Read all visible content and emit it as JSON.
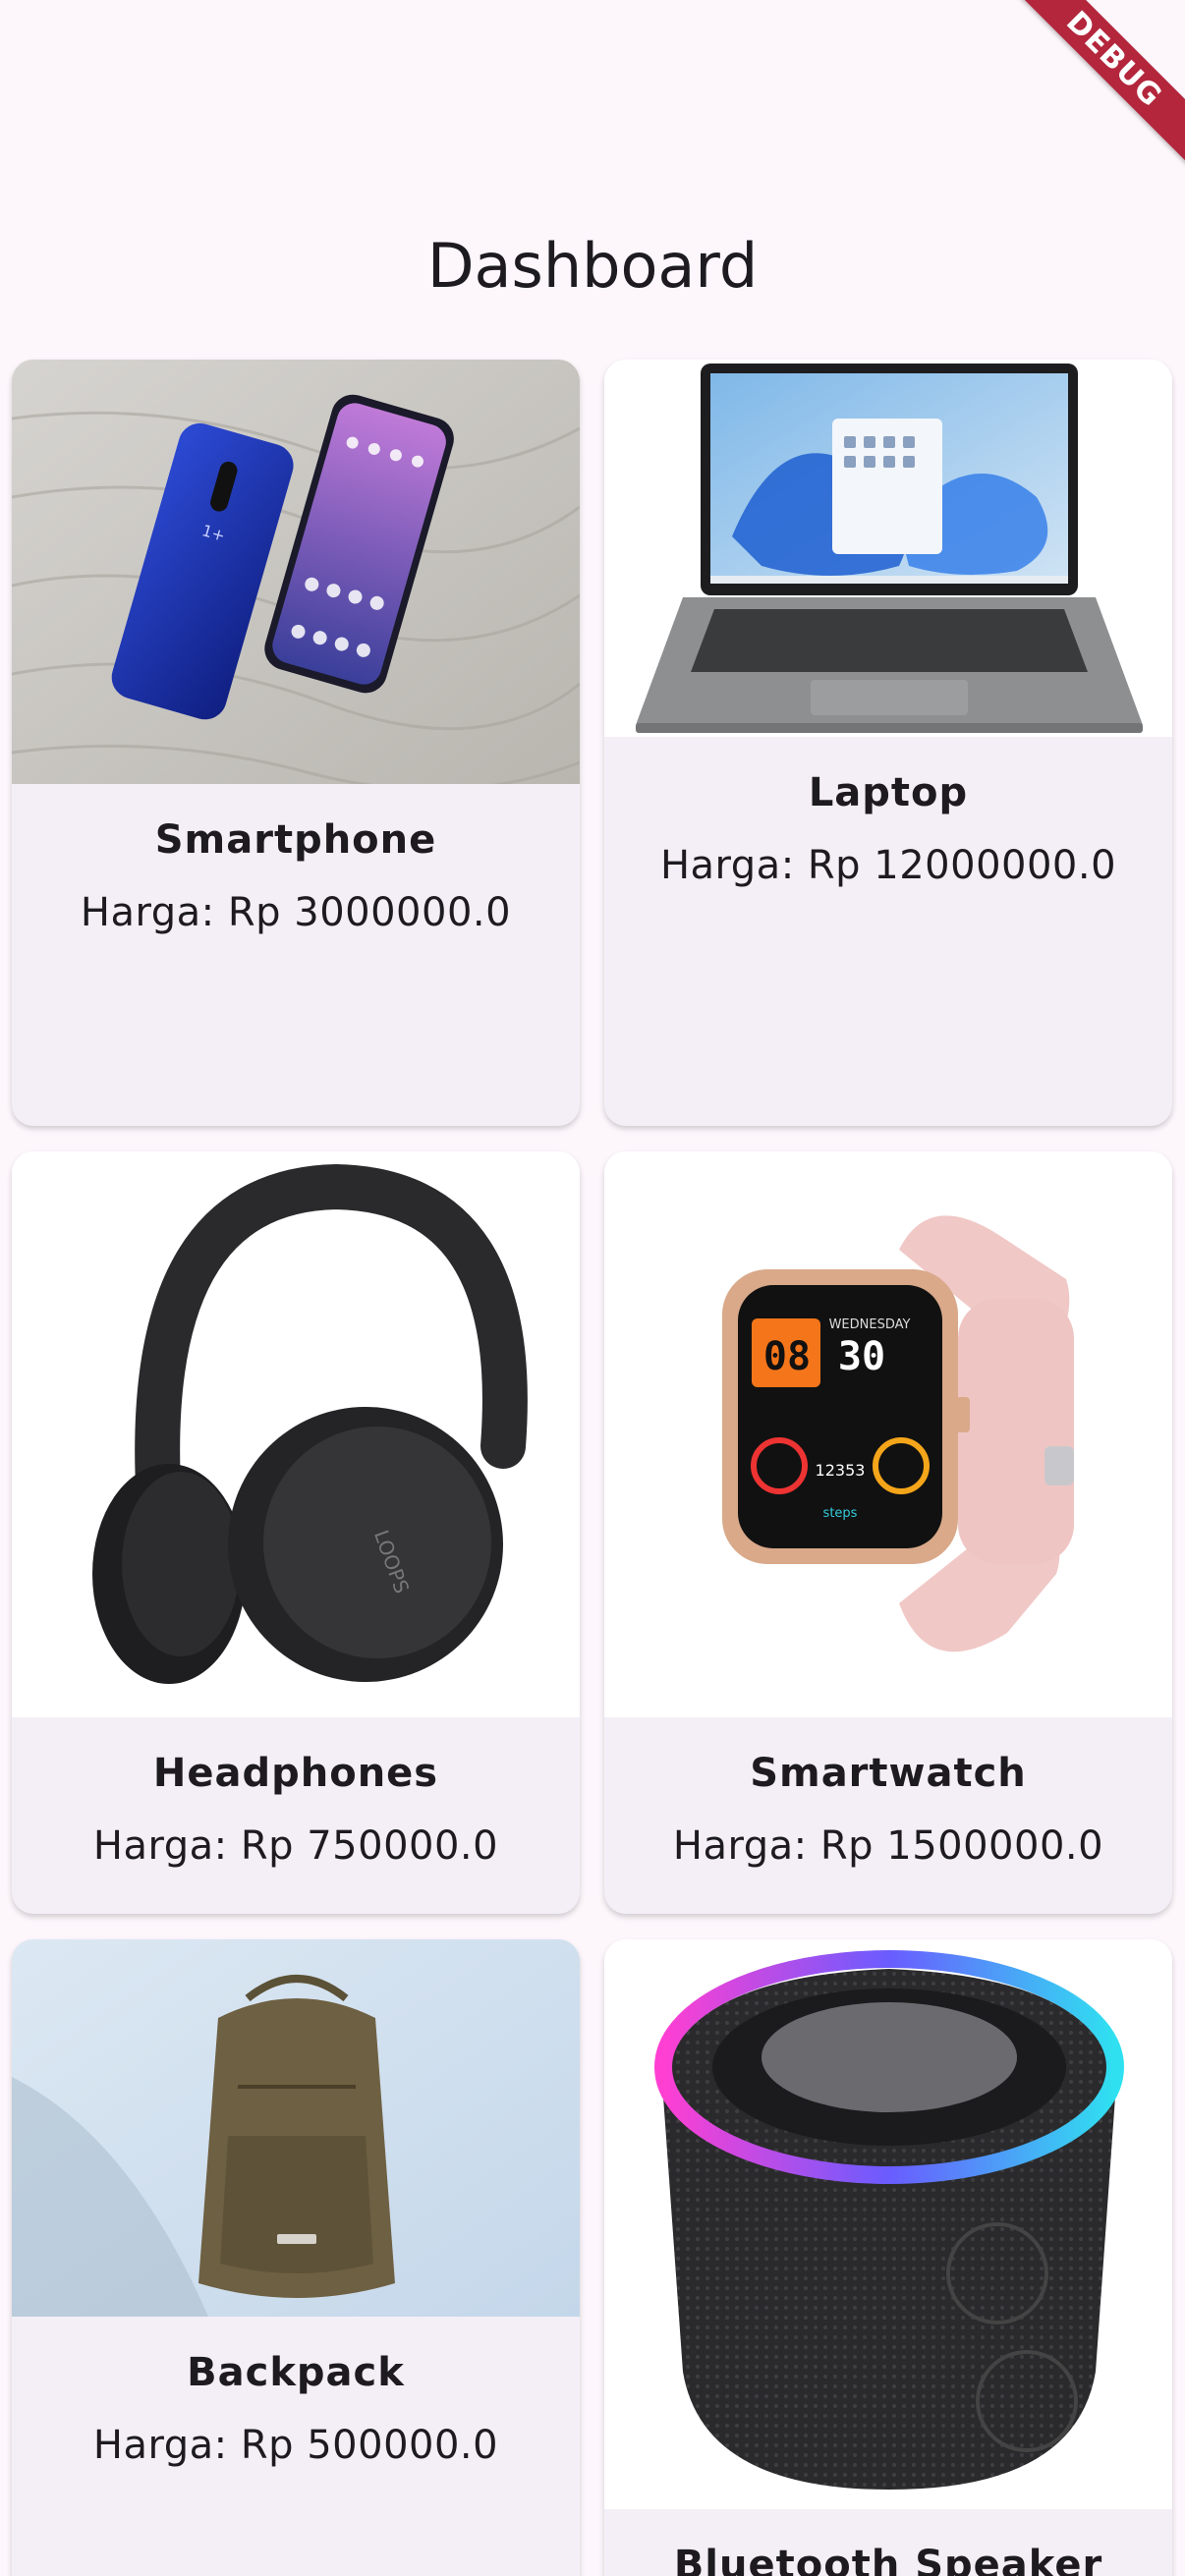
{
  "debug_banner": "DEBUG",
  "app_bar": {
    "title": "Dashboard"
  },
  "products": [
    {
      "name": "Smartphone",
      "price": "Harga: Rp 3000000.0",
      "image": "smartphone-photo"
    },
    {
      "name": "Laptop",
      "price": "Harga: Rp 12000000.0",
      "image": "laptop-photo"
    },
    {
      "name": "Headphones",
      "price": "Harga: Rp 750000.0",
      "image": "headphones-photo"
    },
    {
      "name": "Smartwatch",
      "price": "Harga: Rp 1500000.0",
      "image": "smartwatch-photo"
    },
    {
      "name": "Backpack",
      "price": "Harga: Rp 500000.0",
      "image": "backpack-photo"
    },
    {
      "name": "Bluetooth Speaker",
      "price": "",
      "image": "speaker-photo"
    }
  ],
  "colors": {
    "background": "#fdf7fc",
    "card": "#f4eff6",
    "debug": "#b3263c"
  }
}
